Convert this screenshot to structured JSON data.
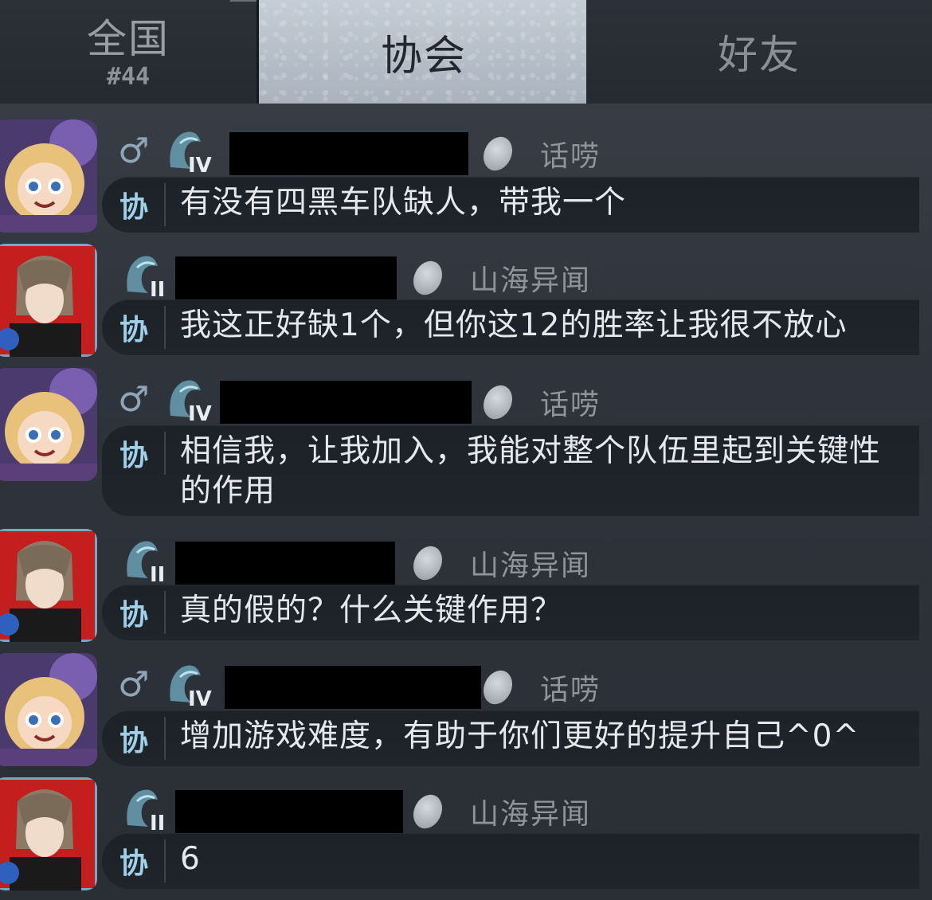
{
  "tabs": {
    "national": {
      "label": "全国",
      "rank": "#44"
    },
    "association": {
      "label": "协会"
    },
    "friends": {
      "label": "好友"
    }
  },
  "messages": [
    {
      "avatar": "chibi-gold-hair-avatar",
      "gender": "♂",
      "tier": "IV",
      "title": "话唠",
      "channel": "协",
      "text": "有没有四黑车队缺人，带我一个"
    },
    {
      "avatar": "dark-hair-red-avatar",
      "gender": "",
      "tier": "II",
      "title": "山海异闻",
      "channel": "协",
      "text": "我这正好缺1个，但你这12的胜率让我很不放心"
    },
    {
      "avatar": "chibi-gold-hair-avatar",
      "gender": "♂",
      "tier": "IV",
      "title": "话唠",
      "channel": "协",
      "text": "相信我，让我加入，我能对整个队伍里起到关键性的作用"
    },
    {
      "avatar": "dark-hair-red-avatar",
      "gender": "",
      "tier": "II",
      "title": "山海异闻",
      "channel": "协",
      "text": "真的假的？什么关键作用？"
    },
    {
      "avatar": "chibi-gold-hair-avatar",
      "gender": "♂",
      "tier": "IV",
      "title": "话唠",
      "channel": "协",
      "text": "增加游戏难度，有助于你们更好的提升自己^0^"
    },
    {
      "avatar": "dark-hair-red-avatar",
      "gender": "",
      "tier": "II",
      "title": "山海异闻",
      "channel": "协",
      "text": "6"
    }
  ]
}
